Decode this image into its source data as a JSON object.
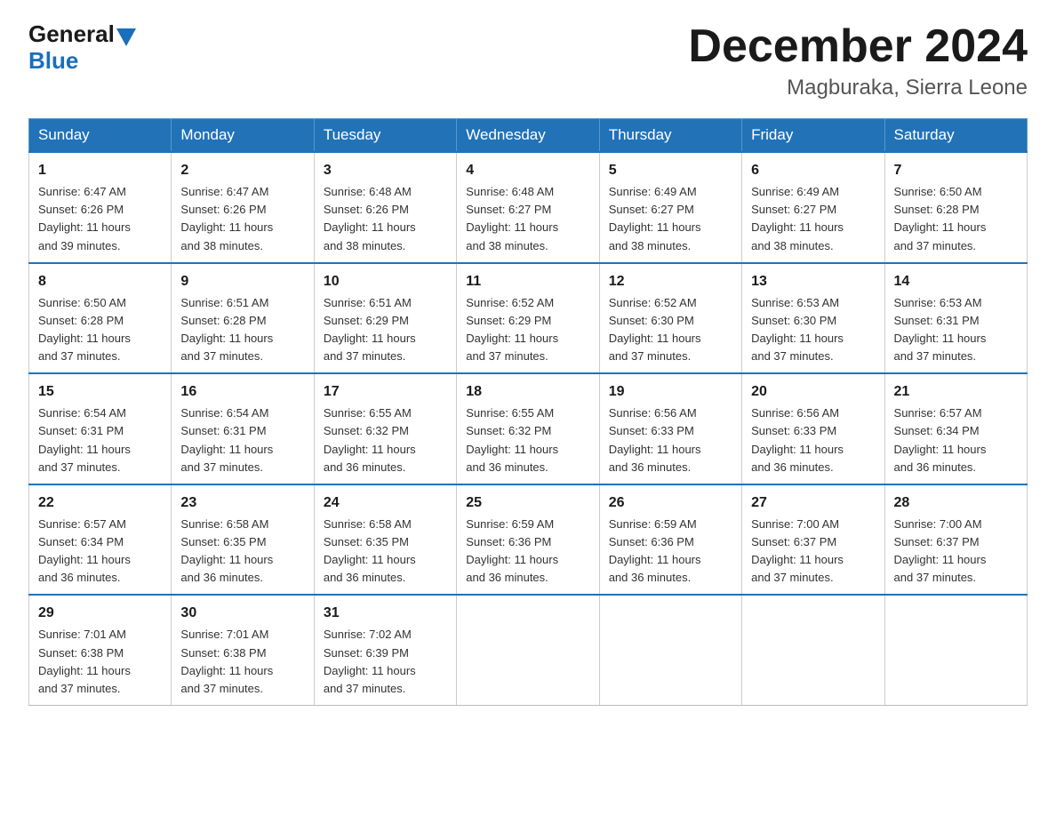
{
  "header": {
    "logo_general": "General",
    "logo_blue": "Blue",
    "title": "December 2024",
    "subtitle": "Magburaka, Sierra Leone"
  },
  "days_of_week": [
    "Sunday",
    "Monday",
    "Tuesday",
    "Wednesday",
    "Thursday",
    "Friday",
    "Saturday"
  ],
  "weeks": [
    [
      {
        "day": "1",
        "sunrise": "6:47 AM",
        "sunset": "6:26 PM",
        "daylight": "11 hours and 39 minutes."
      },
      {
        "day": "2",
        "sunrise": "6:47 AM",
        "sunset": "6:26 PM",
        "daylight": "11 hours and 38 minutes."
      },
      {
        "day": "3",
        "sunrise": "6:48 AM",
        "sunset": "6:26 PM",
        "daylight": "11 hours and 38 minutes."
      },
      {
        "day": "4",
        "sunrise": "6:48 AM",
        "sunset": "6:27 PM",
        "daylight": "11 hours and 38 minutes."
      },
      {
        "day": "5",
        "sunrise": "6:49 AM",
        "sunset": "6:27 PM",
        "daylight": "11 hours and 38 minutes."
      },
      {
        "day": "6",
        "sunrise": "6:49 AM",
        "sunset": "6:27 PM",
        "daylight": "11 hours and 38 minutes."
      },
      {
        "day": "7",
        "sunrise": "6:50 AM",
        "sunset": "6:28 PM",
        "daylight": "11 hours and 37 minutes."
      }
    ],
    [
      {
        "day": "8",
        "sunrise": "6:50 AM",
        "sunset": "6:28 PM",
        "daylight": "11 hours and 37 minutes."
      },
      {
        "day": "9",
        "sunrise": "6:51 AM",
        "sunset": "6:28 PM",
        "daylight": "11 hours and 37 minutes."
      },
      {
        "day": "10",
        "sunrise": "6:51 AM",
        "sunset": "6:29 PM",
        "daylight": "11 hours and 37 minutes."
      },
      {
        "day": "11",
        "sunrise": "6:52 AM",
        "sunset": "6:29 PM",
        "daylight": "11 hours and 37 minutes."
      },
      {
        "day": "12",
        "sunrise": "6:52 AM",
        "sunset": "6:30 PM",
        "daylight": "11 hours and 37 minutes."
      },
      {
        "day": "13",
        "sunrise": "6:53 AM",
        "sunset": "6:30 PM",
        "daylight": "11 hours and 37 minutes."
      },
      {
        "day": "14",
        "sunrise": "6:53 AM",
        "sunset": "6:31 PM",
        "daylight": "11 hours and 37 minutes."
      }
    ],
    [
      {
        "day": "15",
        "sunrise": "6:54 AM",
        "sunset": "6:31 PM",
        "daylight": "11 hours and 37 minutes."
      },
      {
        "day": "16",
        "sunrise": "6:54 AM",
        "sunset": "6:31 PM",
        "daylight": "11 hours and 37 minutes."
      },
      {
        "day": "17",
        "sunrise": "6:55 AM",
        "sunset": "6:32 PM",
        "daylight": "11 hours and 36 minutes."
      },
      {
        "day": "18",
        "sunrise": "6:55 AM",
        "sunset": "6:32 PM",
        "daylight": "11 hours and 36 minutes."
      },
      {
        "day": "19",
        "sunrise": "6:56 AM",
        "sunset": "6:33 PM",
        "daylight": "11 hours and 36 minutes."
      },
      {
        "day": "20",
        "sunrise": "6:56 AM",
        "sunset": "6:33 PM",
        "daylight": "11 hours and 36 minutes."
      },
      {
        "day": "21",
        "sunrise": "6:57 AM",
        "sunset": "6:34 PM",
        "daylight": "11 hours and 36 minutes."
      }
    ],
    [
      {
        "day": "22",
        "sunrise": "6:57 AM",
        "sunset": "6:34 PM",
        "daylight": "11 hours and 36 minutes."
      },
      {
        "day": "23",
        "sunrise": "6:58 AM",
        "sunset": "6:35 PM",
        "daylight": "11 hours and 36 minutes."
      },
      {
        "day": "24",
        "sunrise": "6:58 AM",
        "sunset": "6:35 PM",
        "daylight": "11 hours and 36 minutes."
      },
      {
        "day": "25",
        "sunrise": "6:59 AM",
        "sunset": "6:36 PM",
        "daylight": "11 hours and 36 minutes."
      },
      {
        "day": "26",
        "sunrise": "6:59 AM",
        "sunset": "6:36 PM",
        "daylight": "11 hours and 36 minutes."
      },
      {
        "day": "27",
        "sunrise": "7:00 AM",
        "sunset": "6:37 PM",
        "daylight": "11 hours and 37 minutes."
      },
      {
        "day": "28",
        "sunrise": "7:00 AM",
        "sunset": "6:37 PM",
        "daylight": "11 hours and 37 minutes."
      }
    ],
    [
      {
        "day": "29",
        "sunrise": "7:01 AM",
        "sunset": "6:38 PM",
        "daylight": "11 hours and 37 minutes."
      },
      {
        "day": "30",
        "sunrise": "7:01 AM",
        "sunset": "6:38 PM",
        "daylight": "11 hours and 37 minutes."
      },
      {
        "day": "31",
        "sunrise": "7:02 AM",
        "sunset": "6:39 PM",
        "daylight": "11 hours and 37 minutes."
      },
      null,
      null,
      null,
      null
    ]
  ],
  "labels": {
    "sunrise": "Sunrise: ",
    "sunset": "Sunset: ",
    "daylight": "Daylight: "
  }
}
